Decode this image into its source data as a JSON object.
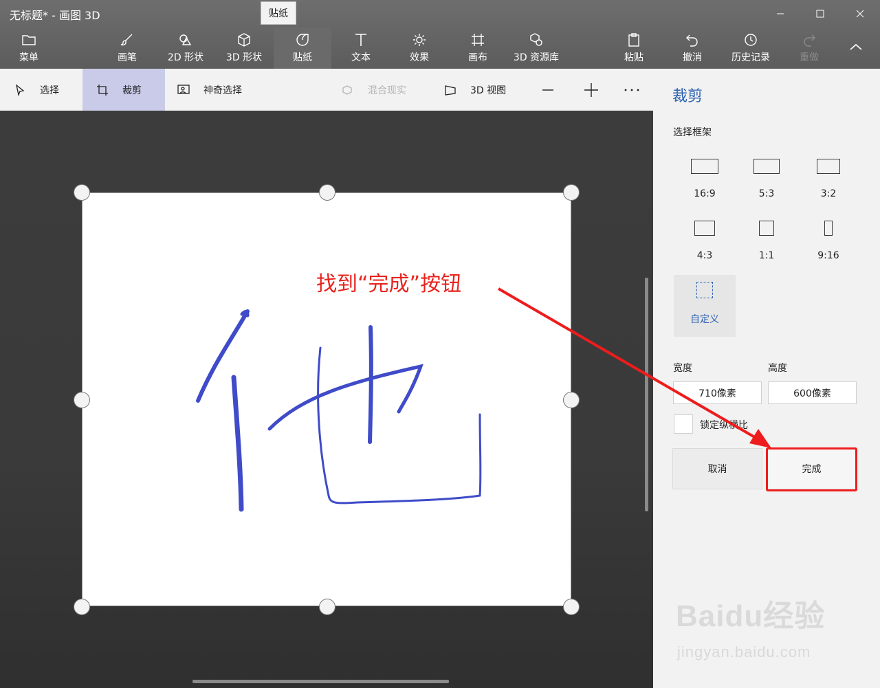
{
  "window": {
    "title": "无标题* - 画图 3D",
    "tooltip": "贴纸"
  },
  "ribbon": {
    "menu": "菜单",
    "brushes": "画笔",
    "shapes2d": "2D 形状",
    "shapes3d": "3D 形状",
    "stickers": "贴纸",
    "text": "文本",
    "effects": "效果",
    "canvas": "画布",
    "library3d": "3D 资源库",
    "paste": "粘贴",
    "undo": "撤消",
    "history": "历史记录",
    "redo": "重做"
  },
  "toolbar": {
    "select": "选择",
    "crop": "裁剪",
    "magic_select": "神奇选择",
    "mixed_reality": "混合现实",
    "view3d": "3D 视图"
  },
  "panel": {
    "title": "裁剪",
    "frame_label": "选择框架",
    "ratios": [
      "16:9",
      "5:3",
      "3:2",
      "4:3",
      "1:1",
      "9:16"
    ],
    "custom": "自定义",
    "width_label": "宽度",
    "height_label": "高度",
    "width_value": "710像素",
    "height_value": "600像素",
    "lock_label": "锁定纵横比",
    "cancel": "取消",
    "done": "完成"
  },
  "annotation": {
    "text": "找到“完成”按钮",
    "color": "#e8231e"
  },
  "watermark": {
    "logo": "Baidu经验",
    "url": "jingyan.baidu.com"
  },
  "colors": {
    "accent": "#2a5fb0",
    "ink": "#3f4bc8",
    "annotation": "#ee1c1c"
  }
}
